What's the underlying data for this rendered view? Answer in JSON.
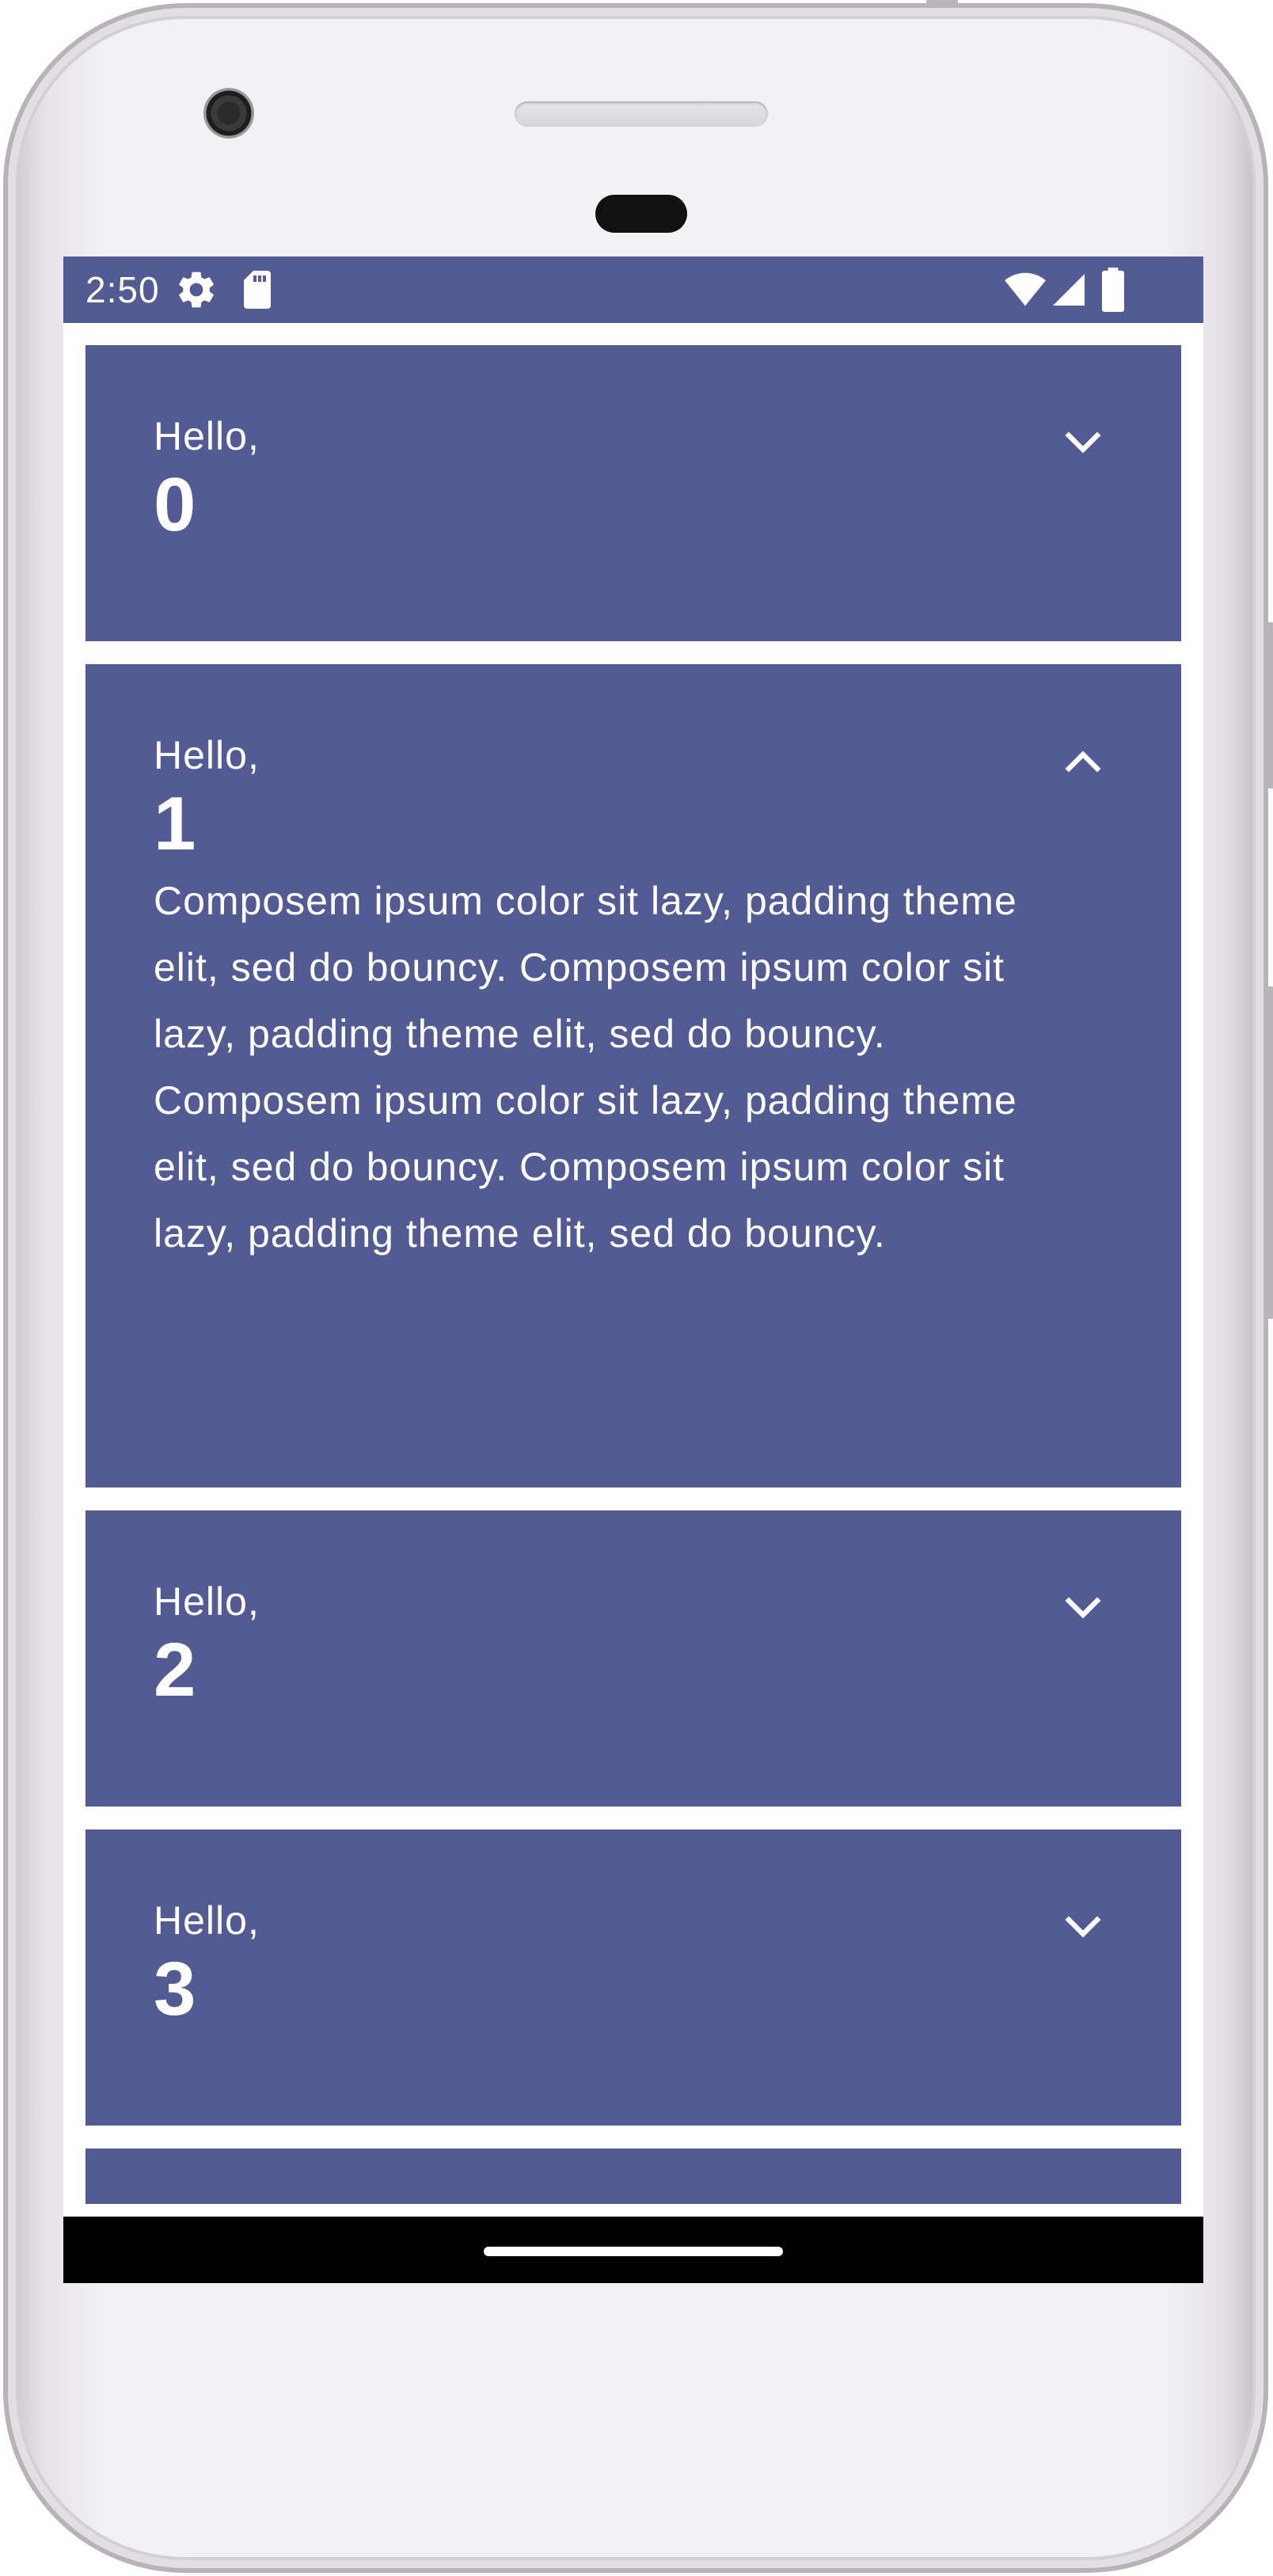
{
  "status_bar": {
    "time": "2:50",
    "background": "#525b94",
    "left_icons": [
      "settings-icon",
      "sd-card-icon"
    ],
    "right_icons": [
      "wifi-icon",
      "cell-signal-icon",
      "battery-icon"
    ]
  },
  "theme": {
    "card_color": "#525b94",
    "text_color": "#ffffff"
  },
  "cards": [
    {
      "greeting": "Hello,",
      "name": "0",
      "expanded": false,
      "toggle_icon": "chevron-down-icon"
    },
    {
      "greeting": "Hello,",
      "name": "1",
      "expanded": true,
      "toggle_icon": "chevron-up-icon",
      "body": "Composem ipsum color sit lazy, padding theme elit, sed do bouncy. Composem ipsum color sit lazy, padding theme elit, sed do bouncy. Composem ipsum color sit lazy, padding theme elit, sed do bouncy. Composem ipsum color sit lazy, padding theme elit, sed do bouncy."
    },
    {
      "greeting": "Hello,",
      "name": "2",
      "expanded": false,
      "toggle_icon": "chevron-down-icon"
    },
    {
      "greeting": "Hello,",
      "name": "3",
      "expanded": false,
      "toggle_icon": "chevron-down-icon"
    }
  ]
}
